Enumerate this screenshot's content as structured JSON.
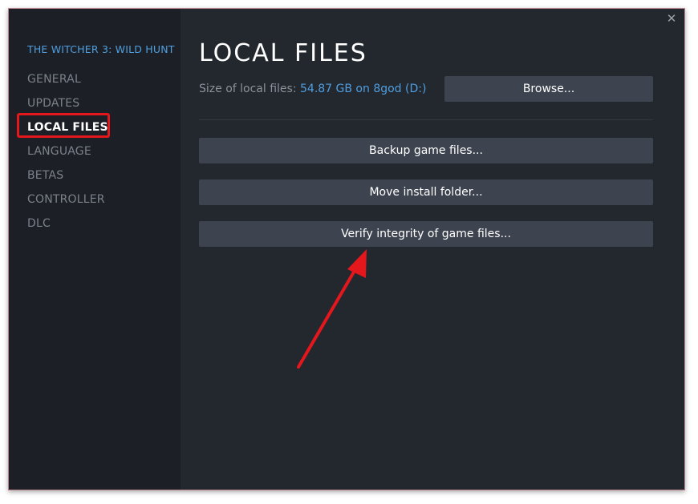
{
  "window": {
    "close_glyph": "✕"
  },
  "sidebar": {
    "game_title": "THE WITCHER 3: WILD HUNT",
    "items": [
      {
        "label": "GENERAL"
      },
      {
        "label": "UPDATES"
      },
      {
        "label": "LOCAL FILES",
        "active": true
      },
      {
        "label": "LANGUAGE"
      },
      {
        "label": "BETAS"
      },
      {
        "label": "CONTROLLER"
      },
      {
        "label": "DLC"
      }
    ]
  },
  "main": {
    "title": "LOCAL FILES",
    "size_label": "Size of local files:",
    "size_value": "54.87 GB on 8god (D:)",
    "browse_label": "Browse...",
    "backup_label": "Backup game files...",
    "move_label": "Move install folder...",
    "verify_label": "Verify integrity of game files..."
  },
  "colors": {
    "window_bg": "#23272e",
    "sidebar_bg": "#1c2026",
    "accent_blue": "#4f9fe0",
    "button_bg": "#3d4450",
    "highlight_red": "#e3171c"
  }
}
